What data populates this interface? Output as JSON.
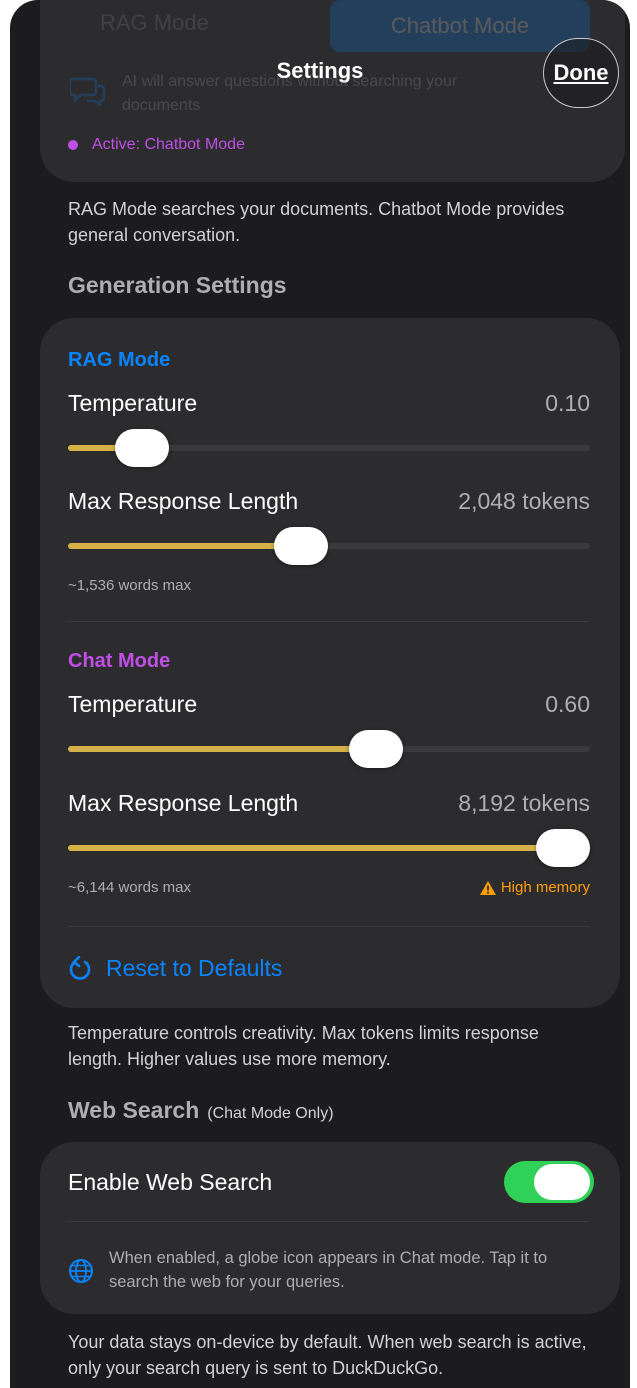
{
  "nav": {
    "title": "Settings",
    "done_label": "Done"
  },
  "mode_card": {
    "segment_rag": "RAG Mode",
    "segment_chat": "Chatbot Mode",
    "description": "AI will answer questions without searching your documents",
    "active_status": "Active: Chatbot Mode"
  },
  "mode_footnote": "RAG Mode searches your documents. Chatbot Mode provides general conversation.",
  "generation": {
    "header": "Generation Settings",
    "rag": {
      "label": "RAG Mode",
      "temperature_label": "Temperature",
      "temperature_value": "0.10",
      "temperature_level": 0.1,
      "max_length_label": "Max Response Length",
      "max_length_value": "2,048 tokens",
      "max_length_level": 0.44,
      "words_hint": "~1,536 words max"
    },
    "chat": {
      "label": "Chat Mode",
      "temperature_label": "Temperature",
      "temperature_value": "0.60",
      "temperature_level": 0.6,
      "max_length_label": "Max Response Length",
      "max_length_value": "8,192 tokens",
      "max_length_level": 1.0,
      "words_hint": "~6,144 words max",
      "warning": "High memory"
    },
    "reset_label": "Reset to Defaults"
  },
  "generation_footnote": "Temperature controls creativity. Max tokens limits response length. Higher values use more memory.",
  "web_search": {
    "header": "Web Search",
    "header_sub": "(Chat Mode Only)",
    "toggle_label": "Enable Web Search",
    "toggle_on": true,
    "info": "When enabled, a globe icon appears in Chat mode. Tap it to search the web for your queries."
  },
  "privacy_footnote": "Your data stays on-device by default. When web search is active, only your search query is sent to DuckDuckGo.",
  "colors": {
    "accent_blue": "#0a84ff",
    "chat_purple": "#bf4fe6",
    "slider_fill": "#d4b247",
    "toggle_green": "#30d158",
    "warning_orange": "#ff9f0a"
  }
}
